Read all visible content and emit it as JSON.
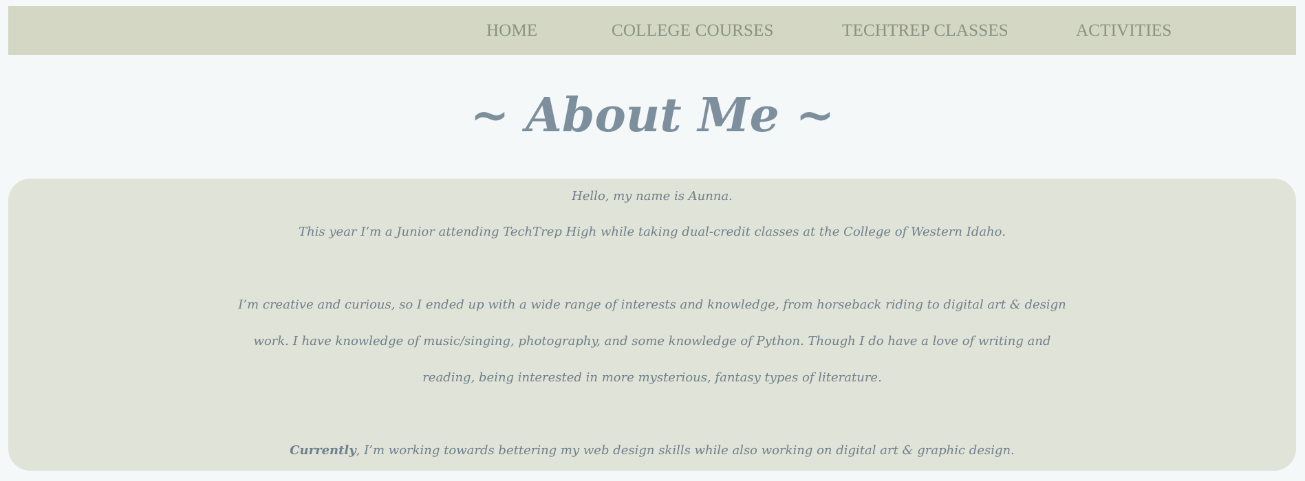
{
  "nav": {
    "items": [
      {
        "label": "HOME"
      },
      {
        "label": "COLLEGE COURSES"
      },
      {
        "label": "TECHTREP CLASSES"
      },
      {
        "label": "ACTIVITIES"
      }
    ]
  },
  "page": {
    "title": "~ About Me ~"
  },
  "about": {
    "greeting": "Hello, my name is Aunna.",
    "intro": "This year I’m a Junior attending TechTrep High while taking dual-credit classes at the College of Western Idaho.",
    "interests_line1": "I’m creative and curious, so I ended up with a wide range of interests and knowledge, from horseback riding to digital art & design",
    "interests_line2": "work. I have knowledge of music/singing, photography, and some knowledge of Python. Though I do have a love of writing and",
    "interests_line3": "reading, being interested in more mysterious, fantasy types of literature.",
    "current_lead": "Currently",
    "current_rest": ", I’m working towards bettering my web design skills while also working on digital art & graphic design."
  },
  "colors": {
    "page_bg": "#f4f8f9",
    "nav_bg": "#d3d7c4",
    "nav_text": "#8a9282",
    "card_bg": "#e0e3d7",
    "title_text": "#7d8f9c",
    "body_text": "#6f7f8b"
  }
}
